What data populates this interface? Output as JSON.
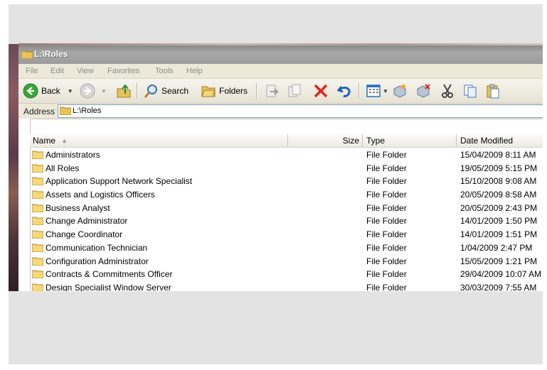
{
  "window": {
    "title": "L:\\Roles"
  },
  "menu": [
    "File",
    "Edit",
    "View",
    "Favorites",
    "Tools",
    "Help"
  ],
  "toolbar": {
    "back_label": "Back",
    "search_label": "Search",
    "folders_label": "Folders"
  },
  "address": {
    "label": "Address",
    "value": "L:\\Roles"
  },
  "columns": {
    "name": "Name",
    "size": "Size",
    "type": "Type",
    "date": "Date Modified"
  },
  "files": [
    {
      "name": "Administrators",
      "type": "File Folder",
      "date": "15/04/2009 8:11 AM"
    },
    {
      "name": "All Roles",
      "type": "File Folder",
      "date": "19/05/2009 5:15 PM"
    },
    {
      "name": "Application Support Network Specialist",
      "type": "File Folder",
      "date": "15/10/2008 9:08 AM"
    },
    {
      "name": "Assets and Logistics Officers",
      "type": "File Folder",
      "date": "20/05/2009 8:58 AM"
    },
    {
      "name": "Business Analyst",
      "type": "File Folder",
      "date": "20/05/2009 2:43 PM"
    },
    {
      "name": "Change Administrator",
      "type": "File Folder",
      "date": "14/01/2009 1:50 PM"
    },
    {
      "name": "Change Coordinator",
      "type": "File Folder",
      "date": "14/01/2009 1:51 PM"
    },
    {
      "name": "Communication Technician",
      "type": "File Folder",
      "date": "1/04/2009 2:47 PM"
    },
    {
      "name": "Configuration Administrator",
      "type": "File Folder",
      "date": "15/05/2009 1:21 PM"
    },
    {
      "name": "Contracts & Commitments Officer",
      "type": "File Folder",
      "date": "29/04/2009 10:07 AM"
    },
    {
      "name": "Design Specialist Window Server",
      "type": "File Folder",
      "date": "30/03/2009 7:55 AM"
    }
  ]
}
